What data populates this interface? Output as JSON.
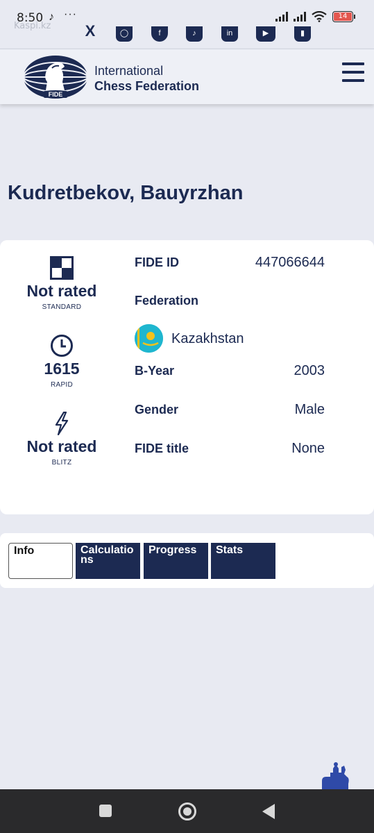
{
  "status_bar": {
    "time": "8:50",
    "notification_icons": [
      "tiktok-icon",
      "more-dots"
    ],
    "watermark": "Kaspi.kz",
    "battery_level": "14",
    "battery_color": "#e4574f"
  },
  "social_icons": [
    "x-icon",
    "instagram-icon",
    "facebook-icon",
    "tiktok-icon",
    "linkedin-icon",
    "youtube-icon",
    "twitch-icon"
  ],
  "header": {
    "logo_text": "FIDE",
    "brand_line1": "International",
    "brand_line2": "Chess Federation"
  },
  "player": {
    "name": "Kudretbekov, Bauyrzhan"
  },
  "ratings": [
    {
      "icon": "standard-board-icon",
      "value": "Not rated",
      "label": "STANDARD"
    },
    {
      "icon": "clock-icon",
      "value": "1615",
      "label": "RAPID"
    },
    {
      "icon": "lightning-icon",
      "value": "Not rated",
      "label": "BLITZ"
    }
  ],
  "profile": {
    "fide_id_label": "FIDE ID",
    "fide_id": "447066644",
    "federation_label": "Federation",
    "federation": "Kazakhstan",
    "byear_label": "B-Year",
    "byear": "2003",
    "gender_label": "Gender",
    "gender": "Male",
    "title_label": "FIDE title",
    "title": "None"
  },
  "tabs": [
    {
      "label": "Info",
      "active": true
    },
    {
      "label": "Calculations",
      "active": false
    },
    {
      "label": "Progress",
      "active": false
    },
    {
      "label": "Stats",
      "active": false
    }
  ],
  "colors": {
    "brand_navy": "#1c2a52",
    "page_bg": "#e8eaf2",
    "flag_blue": "#1fb6cf",
    "flag_gold": "#f2c21b"
  }
}
